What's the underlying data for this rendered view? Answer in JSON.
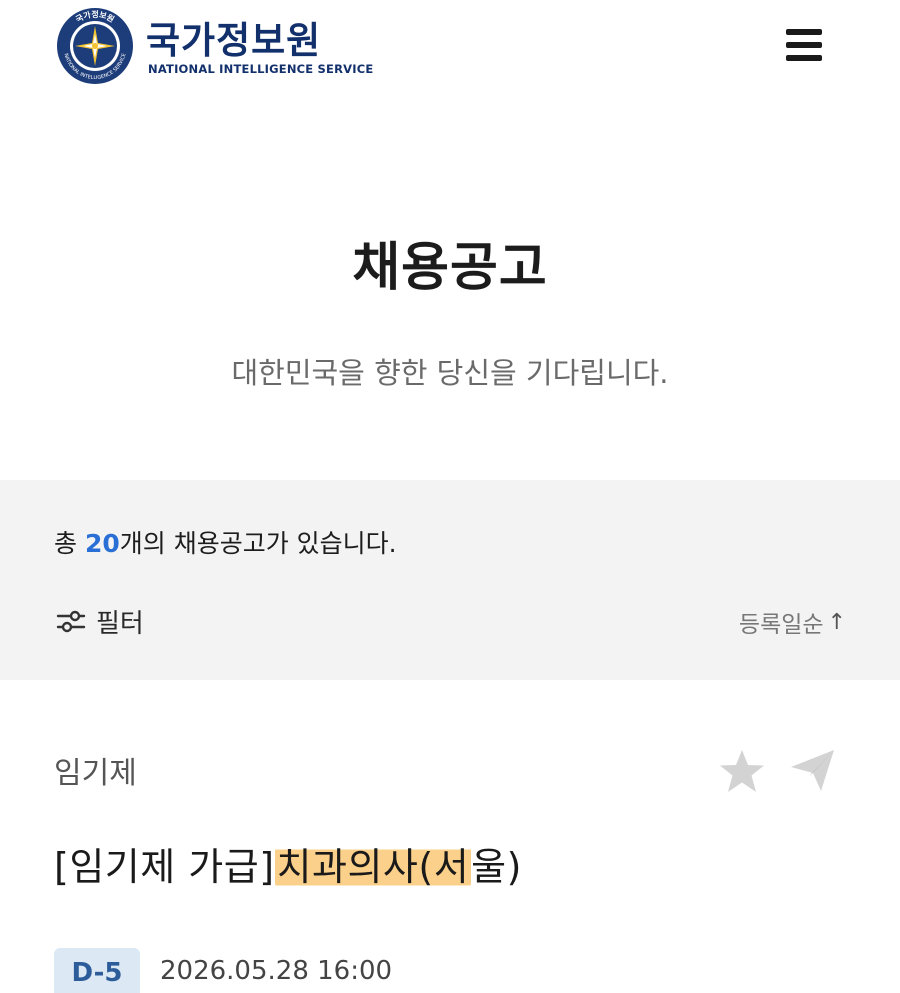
{
  "header": {
    "brand_ko": "국가정보원",
    "brand_en": "NATIONAL INTELLIGENCE SERVICE",
    "logo_ring_top": "국가정보원",
    "logo_ring_bottom": "NATIONAL INTELLIGENCE SERVICE",
    "menu_icon": "hamburger-menu-icon"
  },
  "page": {
    "title": "채용공고",
    "subtitle": "대한민국을 향한 당신을 기다립니다."
  },
  "summary": {
    "count_prefix": "총 ",
    "count": "20",
    "count_suffix": "개의 채용공고가 있습니다.",
    "filter_label": "필터",
    "filter_icon": "sliders-icon",
    "sort_label": "등록일순",
    "sort_arrow": "↑"
  },
  "job": {
    "type": "임기제",
    "title_prefix": "[임기제 가급]",
    "title_highlight": "치과의사(서",
    "title_suffix": "울)",
    "dday": "D-5",
    "deadline": "2026.05.28 16:00",
    "star_icon": "star-icon",
    "share_icon": "send-icon"
  },
  "colors": {
    "brand": "#12306b",
    "accent": "#2a6fd6",
    "highlight": "#fbd08a",
    "dday_bg": "#dde8f5",
    "summary_bg": "#f3f3f3"
  }
}
